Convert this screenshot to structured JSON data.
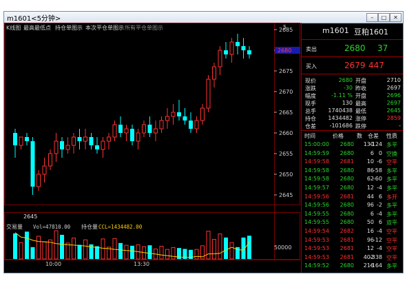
{
  "window": {
    "title": "m1601<5分钟>"
  },
  "toolbar": {
    "items": [
      "K线图",
      "最高最低点",
      "持仓单图示",
      "本次平仓单图示",
      "所有平仓单图示"
    ],
    "period_value": "5"
  },
  "price_axis": {
    "ticks": [
      "2685",
      "2675",
      "2670",
      "2665",
      "2660",
      "2655",
      "2650",
      "2645"
    ],
    "current_price": "2680"
  },
  "low_marker": "2645",
  "volume_panel": {
    "label": "交易量",
    "vol_text": "Vol=47810.00",
    "oi_label": "持仓量",
    "oi_text": "CCL=1434482.00",
    "axis_tick": "50000"
  },
  "time_axis": {
    "labels": [
      "10:00",
      "13:30"
    ]
  },
  "colors": {
    "up": "#ff3232",
    "down": "#00ffff",
    "oi_line": "#ffd200",
    "grid": "#7a0000"
  },
  "chart_data": {
    "type": "candlestick",
    "ylim": [
      2643,
      2686
    ],
    "candles": [
      [
        2660,
        2661,
        2654,
        2657
      ],
      [
        2657,
        2659,
        2656,
        2659
      ],
      [
        2659,
        2660,
        2657,
        2658
      ],
      [
        2658,
        2659,
        2645,
        2647
      ],
      [
        2647,
        2651,
        2646,
        2650
      ],
      [
        2650,
        2654,
        2648,
        2652
      ],
      [
        2652,
        2656,
        2651,
        2655
      ],
      [
        2655,
        2660,
        2653,
        2658
      ],
      [
        2658,
        2659,
        2654,
        2656
      ],
      [
        2656,
        2659,
        2655,
        2657
      ],
      [
        2657,
        2660,
        2655,
        2659
      ],
      [
        2659,
        2661,
        2656,
        2658
      ],
      [
        2658,
        2661,
        2656,
        2659
      ],
      [
        2659,
        2660,
        2656,
        2657
      ],
      [
        2657,
        2659,
        2655,
        2656
      ],
      [
        2656,
        2659,
        2654,
        2658
      ],
      [
        2658,
        2660,
        2656,
        2659
      ],
      [
        2659,
        2663,
        2658,
        2662
      ],
      [
        2662,
        2664,
        2659,
        2660
      ],
      [
        2660,
        2662,
        2658,
        2661
      ],
      [
        2661,
        2662,
        2657,
        2658
      ],
      [
        2658,
        2661,
        2656,
        2660
      ],
      [
        2660,
        2663,
        2659,
        2662
      ],
      [
        2662,
        2664,
        2659,
        2660
      ],
      [
        2660,
        2663,
        2658,
        2661
      ],
      [
        2661,
        2664,
        2660,
        2663
      ],
      [
        2663,
        2666,
        2661,
        2664
      ],
      [
        2664,
        2667,
        2662,
        2665
      ],
      [
        2665,
        2668,
        2663,
        2664
      ],
      [
        2664,
        2666,
        2662,
        2663
      ],
      [
        2663,
        2665,
        2660,
        2661
      ],
      [
        2661,
        2664,
        2660,
        2663
      ],
      [
        2663,
        2667,
        2662,
        2666
      ],
      [
        2666,
        2674,
        2665,
        2673
      ],
      [
        2673,
        2677,
        2671,
        2676
      ],
      [
        2676,
        2681,
        2674,
        2680
      ],
      [
        2680,
        2682,
        2678,
        2679
      ],
      [
        2679,
        2683,
        2677,
        2682
      ],
      [
        2682,
        2684,
        2679,
        2681
      ],
      [
        2681,
        2683,
        2678,
        2680
      ],
      [
        2680,
        2681,
        2678,
        2679
      ]
    ],
    "volumes": [
      5600,
      3600,
      6000,
      2600,
      5000,
      3800,
      4200,
      6200,
      5300,
      3500,
      4600,
      3100,
      4200,
      3200,
      2800,
      4400,
      2600,
      4500,
      3500,
      3000,
      2900,
      3100,
      2700,
      3000,
      2200,
      2800,
      2100,
      2500,
      2400,
      2200,
      2000,
      2100,
      2900,
      6100,
      4300,
      5500,
      4700,
      3600,
      2600,
      4700,
      5100
    ],
    "open_interest": [
      49500,
      47200,
      46800,
      45600,
      45000,
      44800,
      44600,
      43900,
      43600,
      43300,
      43100,
      42900,
      42600,
      42200,
      41900,
      41500,
      41300,
      40900,
      40700,
      40300,
      40100,
      39700,
      39300,
      38900,
      38500,
      38000,
      37700,
      37300,
      37000,
      36900,
      36800,
      37300,
      37100,
      38600,
      38600,
      38900,
      40600,
      42000,
      40800,
      40500,
      44700
    ]
  },
  "quote": {
    "symbol": "m1601",
    "name": "豆粕1601",
    "sell_label": "卖出",
    "sell_price": "2680",
    "sell_qty": "37",
    "buy_label": "买入",
    "buy_price": "2679",
    "buy_qty": "447"
  },
  "stats": [
    {
      "l1": "现价",
      "v1": "2680",
      "c1": "#2bd62b",
      "l2": "开盘",
      "v2": "2710",
      "c2": "#e0e0e0"
    },
    {
      "l1": "涨跌",
      "v1": "-30",
      "c1": "#2bd62b",
      "l2": "昨收",
      "v2": "2697",
      "c2": "#e0e0e0"
    },
    {
      "l1": "幅度",
      "v1": "-1.11 %",
      "c1": "#2bd62b",
      "l2": "开盘",
      "v2": "2696",
      "c2": "#2bd62b"
    },
    {
      "l1": "现手",
      "v1": "130",
      "c1": "#e0e0e0",
      "l2": "最高",
      "v2": "2697",
      "c2": "#2bd62b"
    },
    {
      "l1": "总手",
      "v1": "1740438",
      "c1": "#e0e0e0",
      "l2": "最低",
      "v2": "2645",
      "c2": "#2bd62b"
    },
    {
      "l1": "持仓",
      "v1": "1434482",
      "c1": "#e0e0e0",
      "l2": "涨停",
      "v2": "2859",
      "c2": "#ff3030"
    },
    {
      "l1": "仓差",
      "v1": "-101686",
      "c1": "#e0e0e0",
      "l2": "跌停",
      "v2": "-",
      "c2": "#e0e0e0"
    }
  ],
  "trades_header": [
    "时间",
    "价格",
    "数",
    "仓差",
    "性质"
  ],
  "trades": [
    [
      "15:00:00",
      "2680",
      "130",
      "-124",
      "多平",
      "g"
    ],
    [
      "14:59:59",
      "2680",
      "6",
      "0",
      "空换",
      "g"
    ],
    [
      "14:59:58",
      "2681",
      "10",
      "-6",
      "空平",
      "r"
    ],
    [
      "14:59:58",
      "2680",
      "86",
      "-58",
      "多平",
      "g"
    ],
    [
      "14:59:58",
      "2680",
      "62",
      "-60",
      "多平",
      "g"
    ],
    [
      "14:59:57",
      "2680",
      "12",
      "-4",
      "多平",
      "g"
    ],
    [
      "14:59:56",
      "2681",
      "44",
      "6",
      "多开",
      "r"
    ],
    [
      "14:59:56",
      "2680",
      "96",
      "-2",
      "多平",
      "g"
    ],
    [
      "14:59:55",
      "2680",
      "6",
      "-4",
      "多平",
      "g"
    ],
    [
      "14:59:55",
      "2680",
      "50",
      "6",
      "双平",
      "g"
    ],
    [
      "14:59:54",
      "2682",
      "16",
      "-4",
      "空平",
      "r"
    ],
    [
      "14:59:53",
      "2681",
      "96",
      "-12",
      "空平",
      "r"
    ],
    [
      "14:59:53",
      "2681",
      "12",
      "-4",
      "空平",
      "r"
    ],
    [
      "14:59:53",
      "2681",
      "402",
      "-338",
      "空平",
      "r"
    ],
    [
      "14:59:52",
      "2680",
      "216",
      "-164",
      "多平",
      "g"
    ]
  ]
}
